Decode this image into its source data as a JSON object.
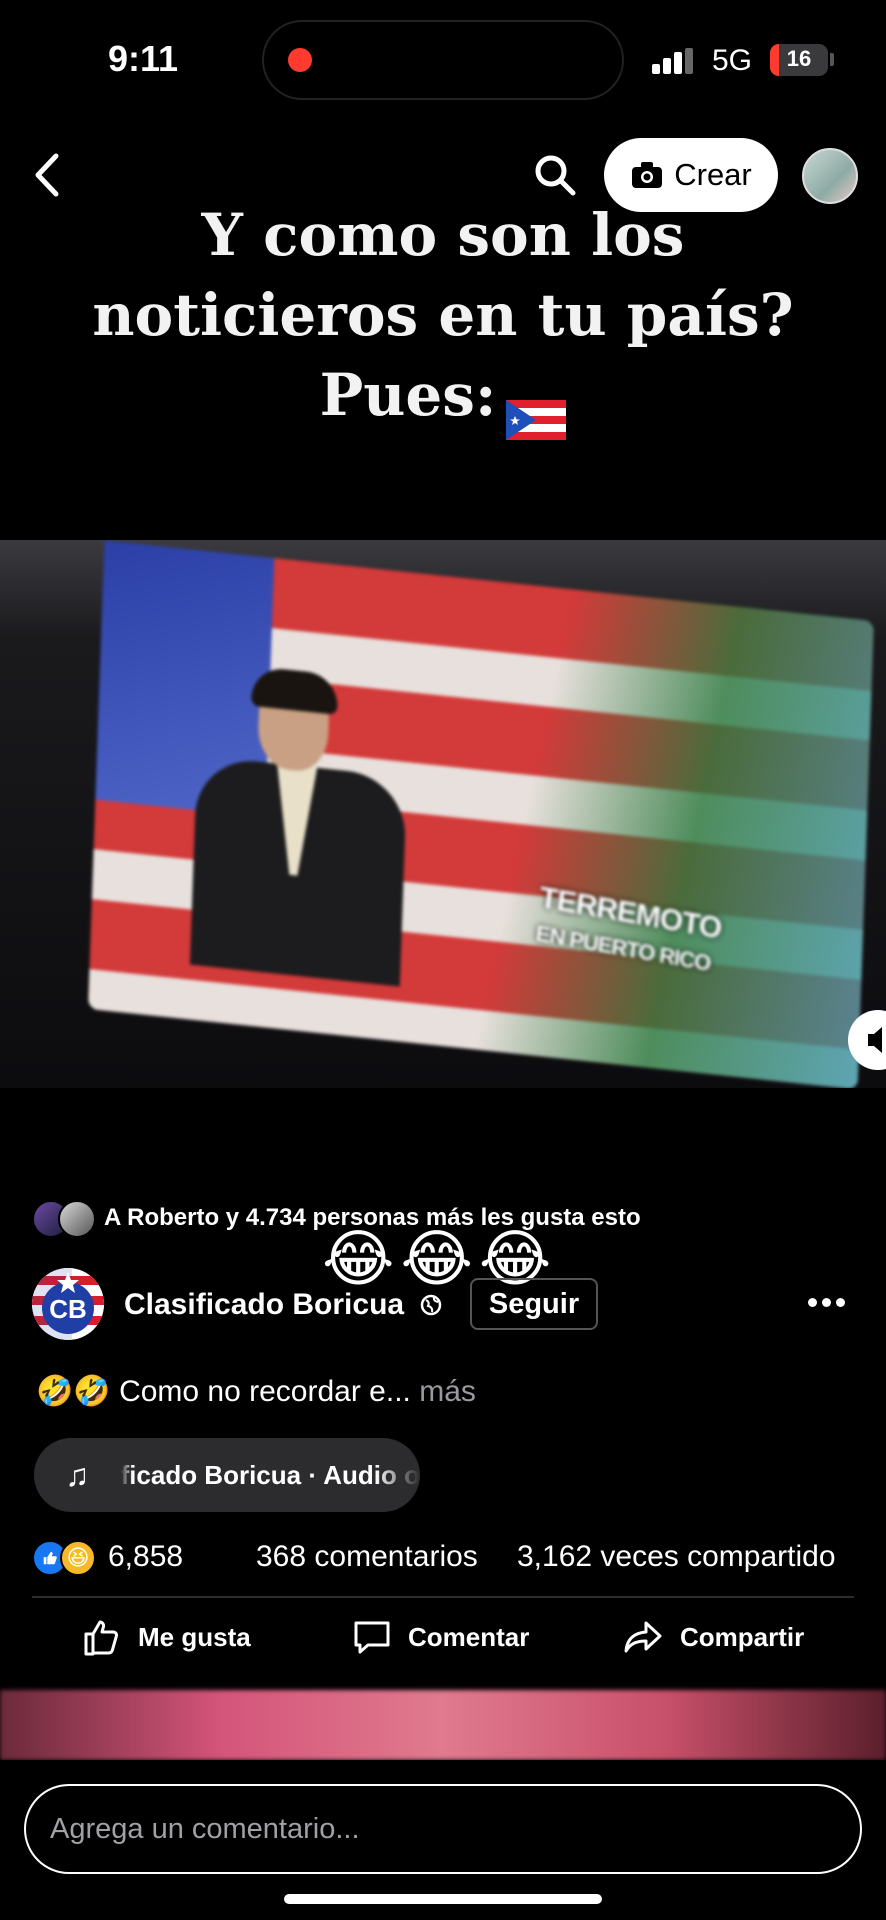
{
  "status_bar": {
    "time": "9:11",
    "network": "5G",
    "battery": "16",
    "battery_level_percent": 16
  },
  "header": {
    "create_label": "Crear"
  },
  "video": {
    "caption_line1": "Y como son los",
    "caption_line2": "noticieros en tu país?",
    "caption_line3": "Pues:",
    "onscreen_text_line1": "TERREMOTO",
    "onscreen_text_line2": "EN PUERTO RICO"
  },
  "likers": {
    "text": "A Roberto y 4.734 personas más les gusta esto",
    "emojis": "😂😂😂"
  },
  "page": {
    "name": "Clasificado Boricua",
    "follow_label": "Seguir",
    "avatar_text": "CB"
  },
  "description": {
    "emojis": "🤣🤣",
    "text": "Como no recordar e...",
    "more_label": "más"
  },
  "audio": {
    "text": "ficado Boricua · Audio o"
  },
  "stats": {
    "reaction_count": "6,858",
    "comments": "368 comentarios",
    "shares": "3,162 veces compartido"
  },
  "actions": {
    "like": "Me gusta",
    "comment": "Comentar",
    "share": "Compartir"
  },
  "comment_box": {
    "placeholder": "Agrega un comentario..."
  },
  "colors": {
    "background": "#000000",
    "accent_blue": "#1877f2",
    "record_red": "#ff3b30"
  }
}
